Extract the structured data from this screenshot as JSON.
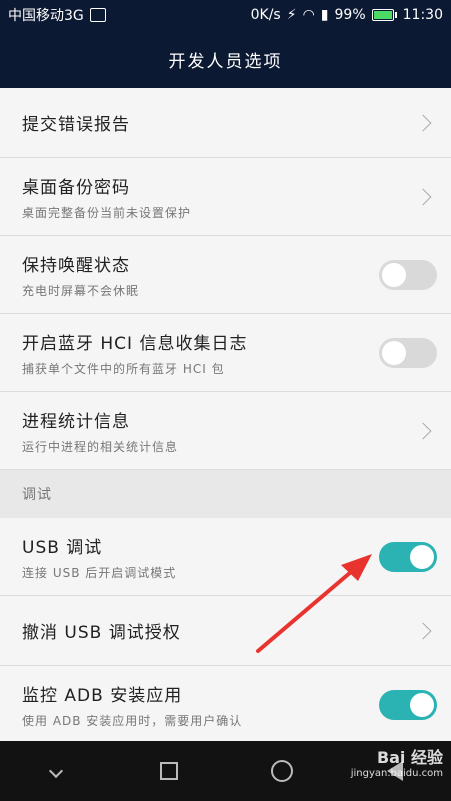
{
  "status_bar": {
    "carrier": "中国移动3G",
    "speed": "0K/s",
    "battery_percent": "99%",
    "time": "11:30"
  },
  "title": "开发人员选项",
  "rows": [
    {
      "title": "提交错误报告",
      "subtitle": "",
      "control": "chevron"
    },
    {
      "title": "桌面备份密码",
      "subtitle": "桌面完整备份当前未设置保护",
      "control": "chevron"
    },
    {
      "title": "保持唤醒状态",
      "subtitle": "充电时屏幕不会休眠",
      "control": "toggle",
      "on": false
    },
    {
      "title": "开启蓝牙 HCI 信息收集日志",
      "subtitle": "捕获单个文件中的所有蓝牙 HCI 包",
      "control": "toggle",
      "on": false
    },
    {
      "title": "进程统计信息",
      "subtitle": "运行中进程的相关统计信息",
      "control": "chevron"
    }
  ],
  "section_debug": "调试",
  "debug_rows": [
    {
      "title": "USB 调试",
      "subtitle": "连接 USB 后开启调试模式",
      "control": "toggle",
      "on": true
    },
    {
      "title": "撤消 USB 调试授权",
      "subtitle": "",
      "control": "chevron"
    },
    {
      "title": "监控 ADB 安装应用",
      "subtitle": "使用 ADB 安装应用时，需要用户确认",
      "control": "toggle",
      "on": true
    }
  ],
  "watermark": {
    "brand": "Bai 经验",
    "url": "jingyan.baidu.com"
  },
  "colors": {
    "header": "#0c1932",
    "toggle_on": "#2bb3b3",
    "toggle_off": "#d9d9d9",
    "annotation_arrow": "#e8332f"
  }
}
